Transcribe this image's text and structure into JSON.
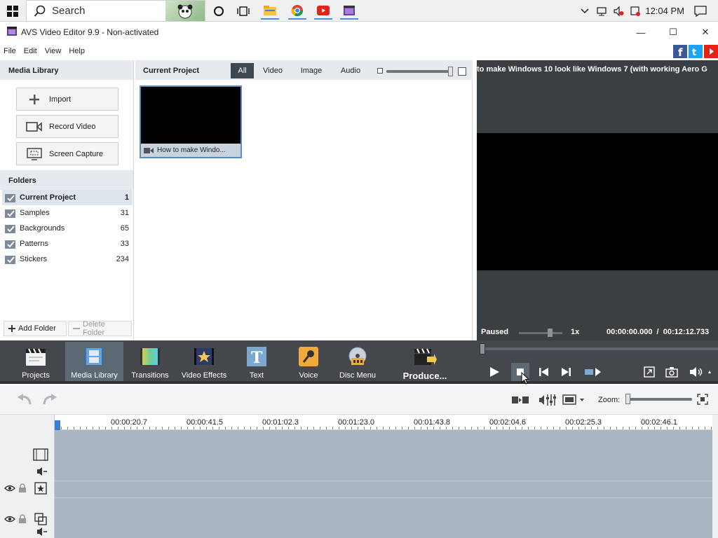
{
  "taskbar": {
    "search_placeholder": "Search",
    "clock": "12:04 PM"
  },
  "window": {
    "title": "AVS Video Editor 9.9 - Non-activated",
    "minimize": "—",
    "maximize": "☐",
    "close": "✕"
  },
  "menu": {
    "file": "File",
    "edit": "Edit",
    "view": "View",
    "help": "Help"
  },
  "media_library": {
    "title": "Media Library",
    "import_label": "Import",
    "record_label": "Record Video",
    "capture_label": "Screen Capture",
    "folders_title": "Folders",
    "folders": [
      {
        "name": "Current Project",
        "count": "1"
      },
      {
        "name": "Samples",
        "count": "31"
      },
      {
        "name": "Backgrounds",
        "count": "65"
      },
      {
        "name": "Patterns",
        "count": "33"
      },
      {
        "name": "Stickers",
        "count": "234"
      }
    ],
    "add_folder": "Add Folder",
    "delete_folder": "Delete Folder"
  },
  "current_project": {
    "title": "Current Project",
    "tabs": [
      "All",
      "Video",
      "Image",
      "Audio"
    ],
    "active_tab": "All",
    "clip_label": "How to make Windo..."
  },
  "preview": {
    "title": "to make Windows 10 look like Windows 7 (with working Aero G",
    "status": "Paused",
    "speed": "1x",
    "time": "00:00:00.000  /  00:12:12.733"
  },
  "toolbar": {
    "items": [
      "Projects",
      "Media Library",
      "Transitions",
      "Video Effects",
      "Text",
      "Voice",
      "Disc Menu",
      "Produce..."
    ],
    "active": "Media Library"
  },
  "timeline": {
    "zoom_label": "Zoom:",
    "ruler": [
      "00:00:20.7",
      "00:00:41.5",
      "00:01:02.3",
      "00:01:23.0",
      "00:01:43.8",
      "00:02:04.6",
      "00:02:25.3",
      "00:02:46.1"
    ]
  },
  "colors": {
    "accent": "#4a90d9",
    "toolbar_bg": "#44484d",
    "timeline_track": "#a9b7c4",
    "preview_bg": "#3c3f42"
  }
}
